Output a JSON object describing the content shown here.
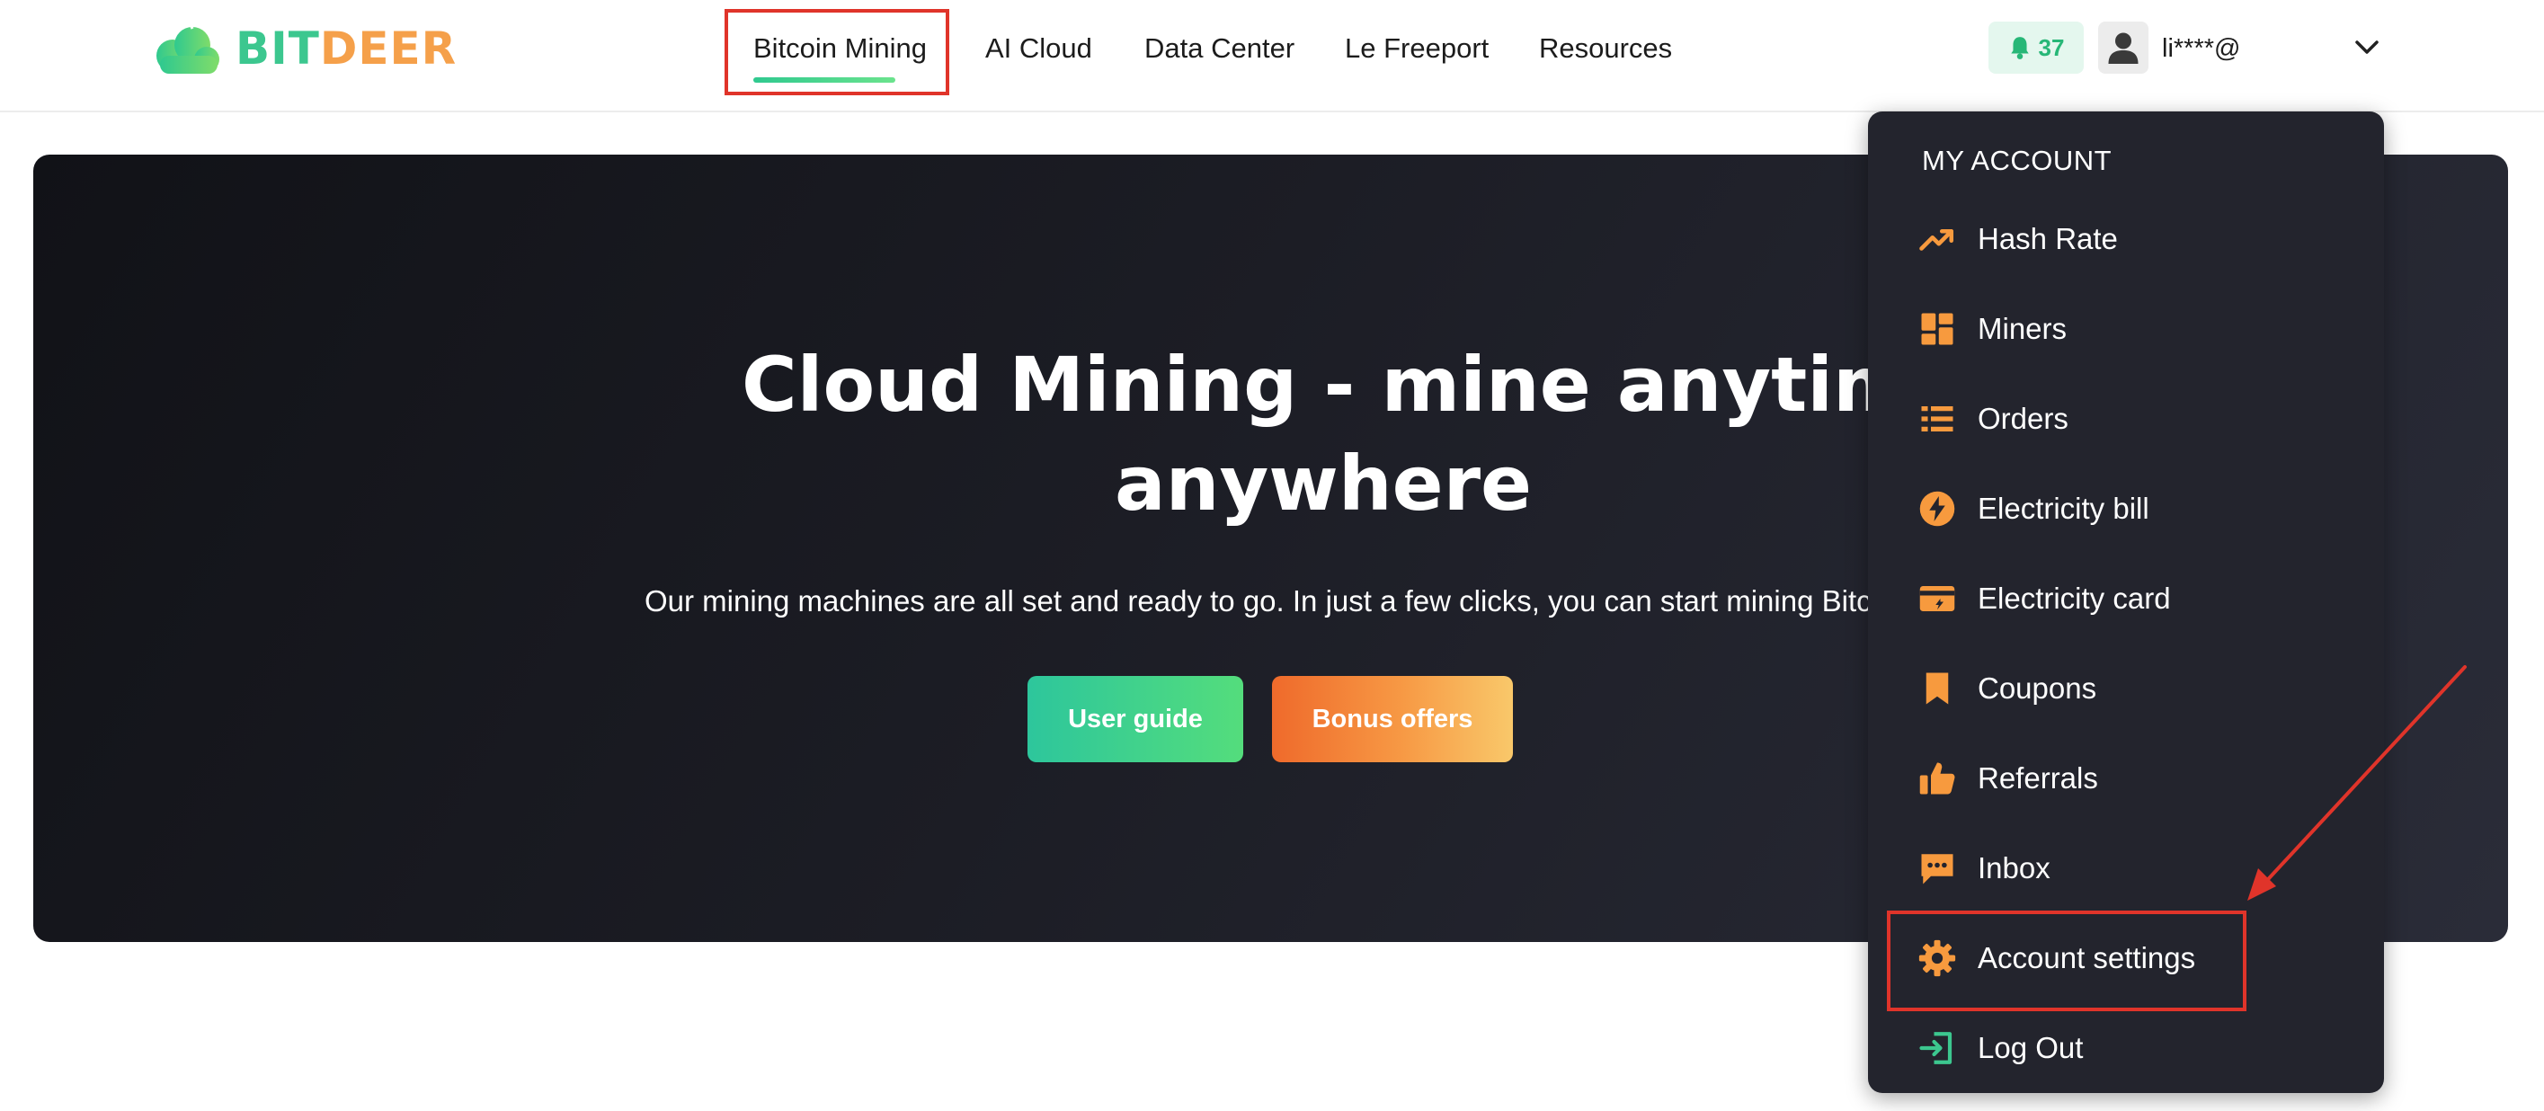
{
  "brand": {
    "logo_part1": "BIT",
    "logo_part2": "DEER"
  },
  "nav": {
    "items": [
      {
        "label": "Bitcoin Mining",
        "active": true
      },
      {
        "label": "AI Cloud"
      },
      {
        "label": "Data Center"
      },
      {
        "label": "Le Freeport"
      },
      {
        "label": "Resources"
      }
    ]
  },
  "header": {
    "notification_count": "37",
    "username": "li****@"
  },
  "hero": {
    "title_line1": "Cloud Mining - mine anytime,",
    "title_line2": "anywhere",
    "subtitle": "Our mining machines are all set and ready to go. In just a few clicks, you can start mining Bitcoi",
    "button_guide": "User guide",
    "button_bonus": "Bonus offers"
  },
  "account_menu": {
    "heading": "MY ACCOUNT",
    "items": [
      {
        "label": "Hash Rate",
        "icon": "trending-up-icon"
      },
      {
        "label": "Miners",
        "icon": "dashboard-icon"
      },
      {
        "label": "Orders",
        "icon": "list-icon"
      },
      {
        "label": "Electricity bill",
        "icon": "lightning-icon"
      },
      {
        "label": "Electricity card",
        "icon": "card-icon"
      },
      {
        "label": "Coupons",
        "icon": "bookmark-icon"
      },
      {
        "label": "Referrals",
        "icon": "thumbs-up-icon"
      },
      {
        "label": "Inbox",
        "icon": "chat-icon"
      },
      {
        "label": "Account settings",
        "icon": "gear-icon"
      },
      {
        "label": "Log Out",
        "icon": "logout-icon"
      }
    ]
  },
  "colors": {
    "accent_green": "#3cc78f",
    "accent_orange": "#f5a04a",
    "annotation_red": "#e0342a",
    "menu_bg": "#23242d"
  }
}
